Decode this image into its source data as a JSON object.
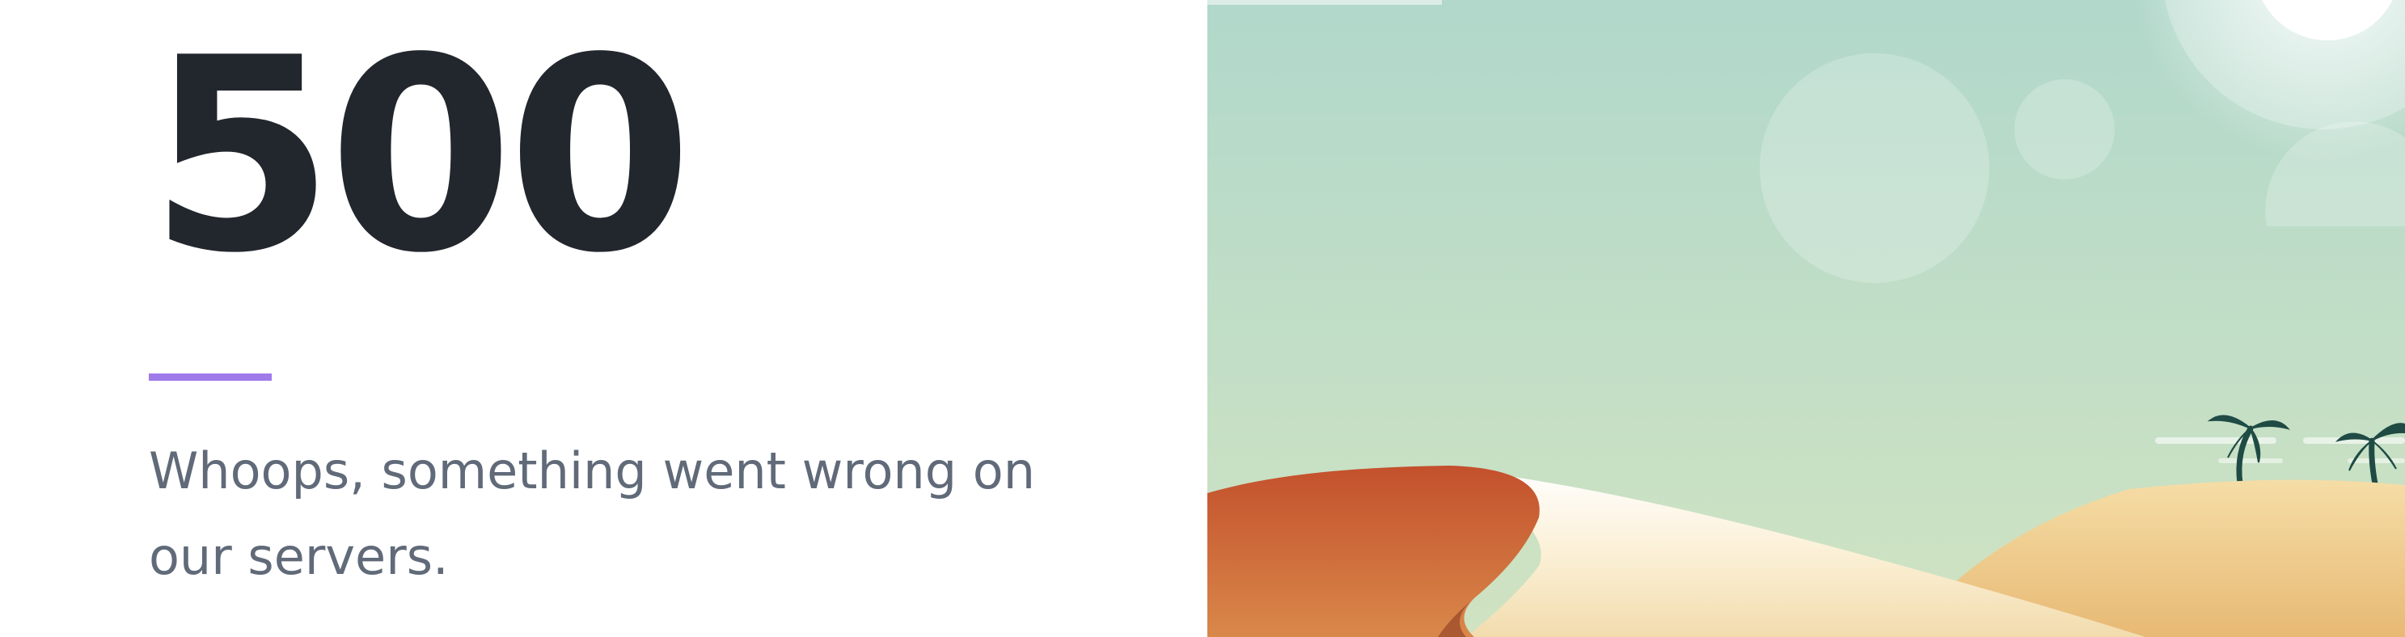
{
  "error": {
    "code": "500",
    "message": "Whoops, something went wrong on our servers."
  },
  "colors": {
    "heading": "#22262d",
    "text": "#606a79",
    "accent": "#9f7aea",
    "sky_top": "#b1d8cb",
    "sky_bottom": "#cfe2c4",
    "dune_red": "#c4532c",
    "sand": "#f0cf94"
  },
  "illustration": "desert-dunes-with-palm-trees"
}
